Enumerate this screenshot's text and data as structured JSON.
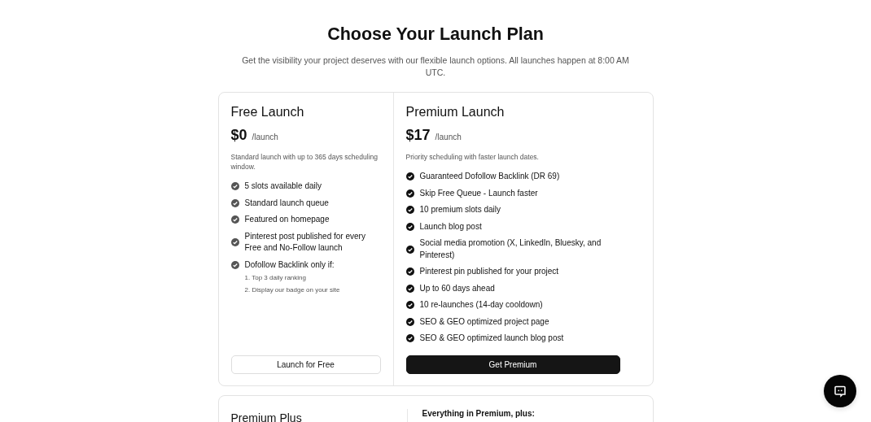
{
  "header": {
    "title": "Choose Your Launch Plan",
    "subtitle": "Get the visibility your project deserves with our flexible launch options. All launches happen at 8:00 AM UTC."
  },
  "plans": [
    {
      "kind": "free",
      "name": "Free Launch",
      "price": "$0",
      "unit": "/launch",
      "description": "Standard launch with up to 365 days scheduling window.",
      "features": [
        {
          "text": "5 slots available daily"
        },
        {
          "text": "Standard launch queue"
        },
        {
          "text": "Featured on homepage"
        },
        {
          "text": "Pinterest post published for every Free and No-Follow launch"
        },
        {
          "text": "Dofollow Backlink only if:",
          "notes": [
            "1. Top 3 daily ranking",
            "2. Display our badge on your site"
          ]
        }
      ],
      "button": "Launch for Free"
    },
    {
      "kind": "premium",
      "name": "Premium Launch",
      "price": "$17",
      "unit": "/launch",
      "description": "Priority scheduling with faster launch dates.",
      "features": [
        {
          "text": "Guaranteed Dofollow Backlink (DR 69)"
        },
        {
          "text": "Skip Free Queue - Launch faster"
        },
        {
          "text": "10 premium slots daily"
        },
        {
          "text": "Launch blog post"
        },
        {
          "text": "Social media promotion (X, LinkedIn, Bluesky, and Pinterest)"
        },
        {
          "text": "Pinterest pin published for your project"
        },
        {
          "text": "Up to 60 days ahead"
        },
        {
          "text": "10 re-launches (14-day cooldown)"
        },
        {
          "text": "SEO & GEO optimized project page"
        },
        {
          "text": "SEO & GEO optimized launch blog post"
        }
      ],
      "button": "Get Premium"
    }
  ],
  "plus_plan": {
    "name": "Premium Plus",
    "intro": "Everything in Premium, plus:"
  }
}
